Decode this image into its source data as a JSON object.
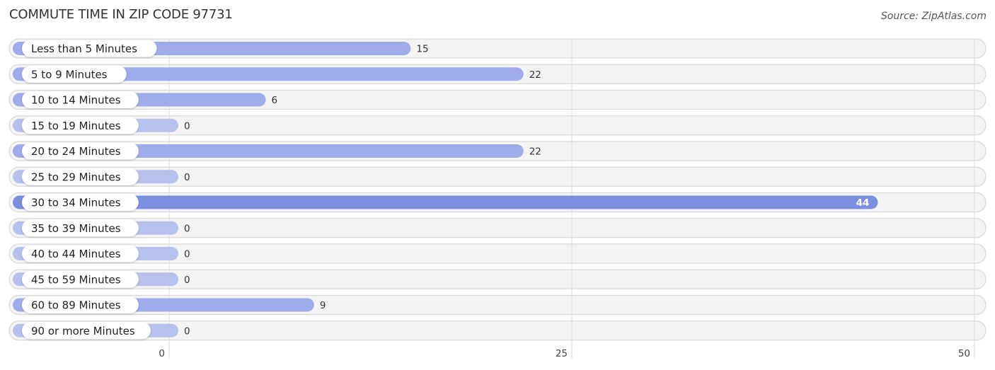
{
  "chart_data": {
    "type": "bar",
    "orientation": "horizontal",
    "title": "COMMUTE TIME IN ZIP CODE 97731",
    "source": "Source: ZipAtlas.com",
    "categories": [
      "Less than 5 Minutes",
      "5 to 9 Minutes",
      "10 to 14 Minutes",
      "15 to 19 Minutes",
      "20 to 24 Minutes",
      "25 to 29 Minutes",
      "30 to 34 Minutes",
      "35 to 39 Minutes",
      "40 to 44 Minutes",
      "45 to 59 Minutes",
      "60 to 89 Minutes",
      "90 or more Minutes"
    ],
    "values": [
      15,
      22,
      6,
      0,
      22,
      0,
      44,
      0,
      0,
      0,
      9,
      0
    ],
    "value_labels": [
      "15",
      "22",
      "6",
      "0",
      "22",
      "0",
      "44",
      "0",
      "0",
      "0",
      "9",
      "0"
    ],
    "highlight_index": 6,
    "xlabel": "",
    "ylabel": "",
    "xlim": [
      0,
      50
    ],
    "xticks": [
      0,
      25,
      50
    ],
    "xtick_labels": [
      "0",
      "25",
      "50"
    ],
    "grid": true,
    "legend": "none",
    "colors": {
      "bar": "#a0acea",
      "bar_zero": "#b8c1ee",
      "bar_highlight": "#7b8fe0",
      "track": "#f4f4f4",
      "track_border": "#d9d9d9",
      "grid": "#dddddd"
    }
  }
}
